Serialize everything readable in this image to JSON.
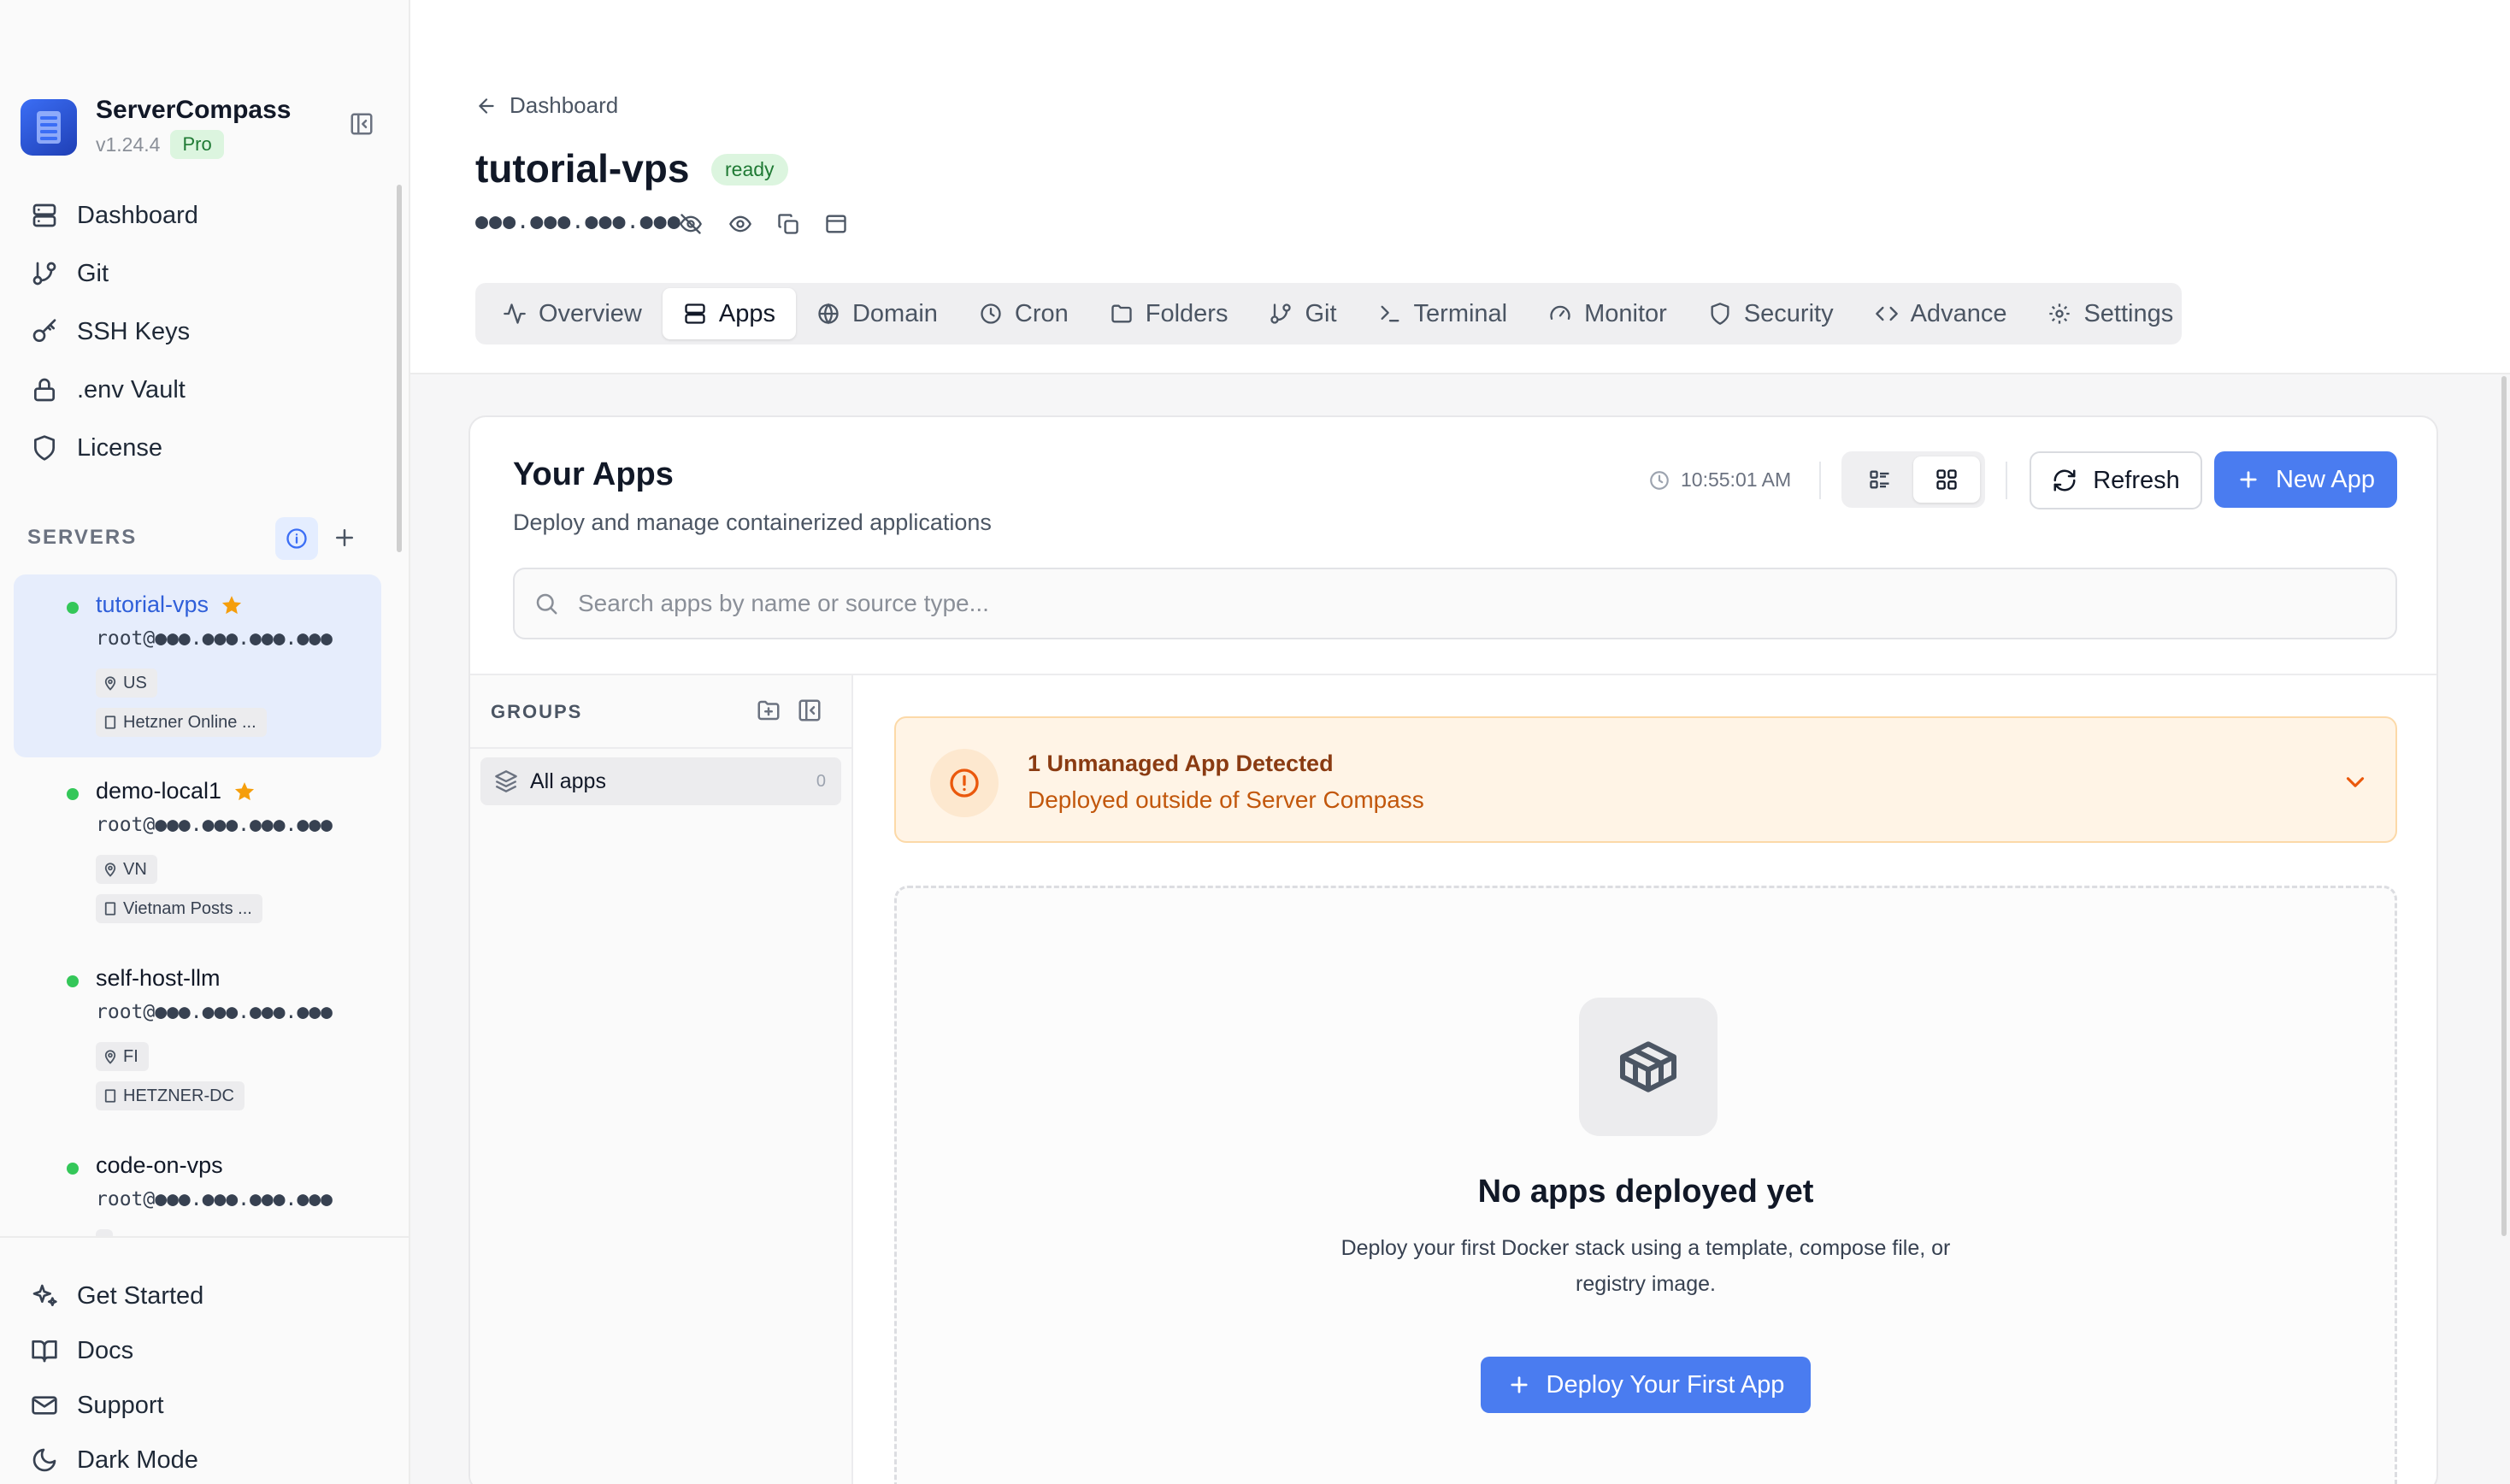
{
  "app": {
    "name": "ServerCompass",
    "version": "v1.24.4",
    "plan_badge": "Pro"
  },
  "sidebar": {
    "nav": [
      {
        "label": "Dashboard",
        "icon": "server-stack-icon"
      },
      {
        "label": "Git",
        "icon": "git-branch-icon"
      },
      {
        "label": "SSH Keys",
        "icon": "key-icon"
      },
      {
        "label": ".env Vault",
        "icon": "lock-icon"
      },
      {
        "label": "License",
        "icon": "shield-icon"
      }
    ],
    "servers_label": "SERVERS",
    "servers": [
      {
        "name": "tutorial-vps",
        "host": "root@●●●.●●●.●●●.●●●",
        "region": "US",
        "provider": "Hetzner Online ...",
        "favorite": true,
        "status": "online",
        "active": true
      },
      {
        "name": "demo-local1",
        "host": "root@●●●.●●●.●●●.●●●",
        "region": "VN",
        "provider": "Vietnam Posts ...",
        "favorite": true,
        "status": "online",
        "active": false
      },
      {
        "name": "self-host-llm",
        "host": "root@●●●.●●●.●●●.●●●",
        "region": "FI",
        "provider": "HETZNER-DC",
        "favorite": false,
        "status": "online",
        "active": false
      },
      {
        "name": "code-on-vps",
        "host": "root@●●●.●●●.●●●.●●●",
        "region": "",
        "provider": "",
        "favorite": false,
        "status": "online",
        "active": false
      }
    ],
    "bottom": [
      {
        "label": "Get Started",
        "icon": "sparkles-icon"
      },
      {
        "label": "Docs",
        "icon": "book-icon"
      },
      {
        "label": "Support",
        "icon": "mail-icon"
      },
      {
        "label": "Dark Mode",
        "icon": "moon-icon"
      }
    ]
  },
  "header": {
    "back_label": "Dashboard",
    "server_name": "tutorial-vps",
    "status": "ready",
    "masked_ip": "●●●.●●●.●●●.●●●"
  },
  "tabs": [
    {
      "label": "Overview",
      "icon": "activity-icon",
      "active": false
    },
    {
      "label": "Apps",
      "icon": "apps-icon",
      "active": true
    },
    {
      "label": "Domain",
      "icon": "globe-icon",
      "active": false
    },
    {
      "label": "Cron",
      "icon": "clock-icon",
      "active": false
    },
    {
      "label": "Folders",
      "icon": "folder-icon",
      "active": false
    },
    {
      "label": "Git",
      "icon": "git-branch-icon",
      "active": false
    },
    {
      "label": "Terminal",
      "icon": "terminal-icon",
      "active": false
    },
    {
      "label": "Monitor",
      "icon": "gauge-icon",
      "active": false
    },
    {
      "label": "Security",
      "icon": "shield-icon",
      "active": false
    },
    {
      "label": "Advance",
      "icon": "code-icon",
      "active": false
    },
    {
      "label": "Settings",
      "icon": "gear-icon",
      "active": false
    }
  ],
  "apps_panel": {
    "title": "Your Apps",
    "subtitle": "Deploy and manage containerized applications",
    "last_updated": "10:55:01 AM",
    "view_mode": "grid",
    "refresh_label": "Refresh",
    "new_app_label": "New App",
    "search_placeholder": "Search apps by name or source type..."
  },
  "groups": {
    "label": "GROUPS",
    "items": [
      {
        "label": "All apps",
        "count": "0"
      }
    ]
  },
  "alert": {
    "title": "1 Unmanaged App Detected",
    "subtitle": "Deployed outside of Server Compass"
  },
  "empty_state": {
    "title": "No apps deployed yet",
    "description": "Deploy your first Docker stack using a template, compose file, or registry image.",
    "button_label": "Deploy Your First App"
  },
  "colors": {
    "accent": "#4a7cf0",
    "active_server_bg": "#e6edfc",
    "status_online": "#34c759",
    "favorite_star": "#f59e0b",
    "alert_bg": "#fff4e6",
    "alert_text": "#c2570c",
    "ready_badge_bg": "#dcf5df"
  }
}
